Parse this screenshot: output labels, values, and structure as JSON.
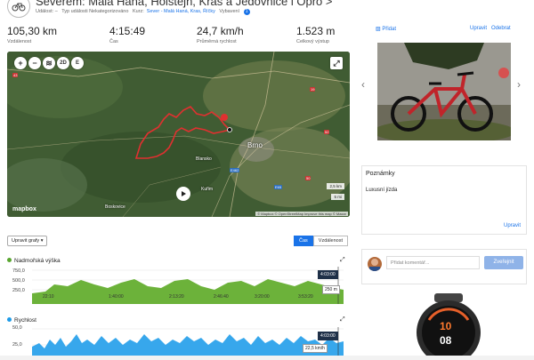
{
  "header": {
    "title": "Severem: Malá Haná, Holštejn, Kras a Jedovnice i Opro",
    "title_suffix": ">",
    "meta": {
      "event_label": "Událost: –",
      "type_label": "Typ události Nekategorizováno",
      "course_label": "Kurz:",
      "course_value": "Sever - Malá Haná, Kras, Říčky",
      "gear_label": "Vybavení",
      "gear_count": "1"
    }
  },
  "stats": [
    {
      "value": "105,30 km",
      "label": "Vzdálenost"
    },
    {
      "value": "4:15:49",
      "label": "Čas"
    },
    {
      "value": "24,7 km/h",
      "label": "Průměrná rychlost"
    },
    {
      "value": "1.523 m",
      "label": "Celkový výstup"
    }
  ],
  "map": {
    "controls": {
      "zoom_in": "+",
      "zoom_out": "−",
      "layers": "≋",
      "mode": "2D",
      "extra": "E"
    },
    "labels": {
      "city": "Brno",
      "town1": "Blansko",
      "town2": "Kuřim",
      "town3": "Boskovice"
    },
    "road_badges": [
      "43",
      "19",
      "52",
      "50",
      "E462",
      "E65"
    ],
    "scale_a": "2,5 km",
    "scale_b": "5 mi",
    "brand": "mapbox",
    "attribution": "© Mapbox © OpenStreetMap  Improve this map  © Maxar"
  },
  "chart_controls": {
    "edit_graphs": "Upravit grafy ▾",
    "toggle_time": "Čas",
    "toggle_distance": "Vzdálenost"
  },
  "elevation_chart": {
    "title": "Nadmořská výška",
    "y_ticks": [
      "750,0",
      "500,0",
      "250,0"
    ],
    "x_labels": [
      "22:10",
      "1:40:00",
      "2:13:20",
      "2:46:40",
      "3:20:00",
      "3:53:20"
    ],
    "cursor_time": "4:03:00",
    "cursor_value": "250 m",
    "color": "#59a630"
  },
  "speed_chart": {
    "title": "Rychlost",
    "y_ticks": [
      "50,0",
      "25,0"
    ],
    "cursor_time": "4:03:00",
    "cursor_value": "22,5 km/h",
    "color": "#1e9be8"
  },
  "photos": {
    "add_label": "Přidat",
    "edit_label": "Upravit",
    "delete_label": "Odebrat",
    "count": 4,
    "active_index": 0
  },
  "notes": {
    "heading": "Poznámky",
    "text": "Luxusní jízda",
    "edit_label": "Upravit"
  },
  "comment": {
    "placeholder": "Přidat komentář...",
    "post_label": "Zveřejnit"
  },
  "watch": {
    "time_top": "10",
    "time_bottom": "08"
  }
}
